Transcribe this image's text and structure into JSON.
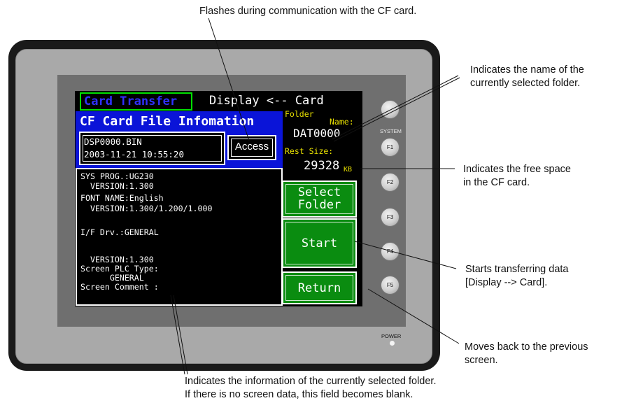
{
  "callouts": {
    "top": "Flashes during communication with the CF card.",
    "folder_name_1": "Indicates the name of the",
    "folder_name_2": "currently selected folder.",
    "free_space_1": "Indicates the free space",
    "free_space_2": "in the CF card.",
    "start_1": "Starts transferring data",
    "start_2": "[Display --> Card].",
    "return_1": "Moves back to the previous",
    "return_2": "screen.",
    "bottom_1": "Indicates the information of the currently selected folder.",
    "bottom_2": "If there is no screen data, this field becomes blank."
  },
  "screen": {
    "title": "Card Transfer",
    "mode": "Display <-- Card",
    "panel_title": "CF Card File Infomation",
    "file_name": "DSP0000.BIN",
    "file_date": "2003-11-21 10:55:20",
    "access_label": "Access",
    "folder_label_1": "Folder",
    "folder_label_2": "Name:",
    "folder_value": "DAT0000",
    "rest_label": "Rest Size:",
    "rest_value": "29328",
    "rest_unit": "KB",
    "info_lines": [
      "SYS PROG.:UG230",
      "  VERSION:1.300",
      "FONT NAME:English",
      "  VERSION:1.300/1.200/1.000",
      "I/F Drv.:GENERAL",
      "  VERSION:1.300",
      "Screen PLC Type:",
      "      GENERAL",
      "Screen Comment :"
    ],
    "btn_select_1": "Select",
    "btn_select_2": "Folder",
    "btn_start": "Start",
    "btn_return": "Return"
  },
  "device": {
    "system_label": "SYSTEM",
    "power_label": "POWER",
    "keys": [
      "F1",
      "F2",
      "F3",
      "F4",
      "F5"
    ]
  }
}
